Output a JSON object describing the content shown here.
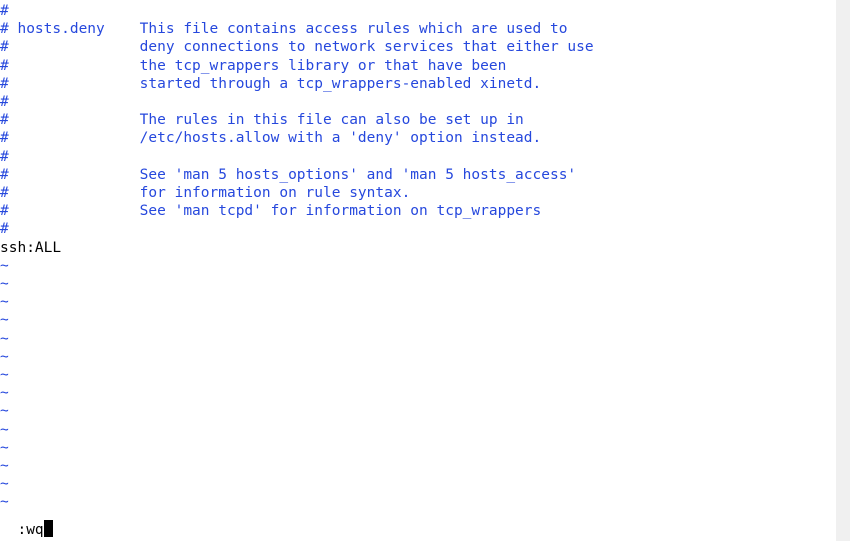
{
  "file_lines": [
    "#",
    "# hosts.deny    This file contains access rules which are used to",
    "#               deny connections to network services that either use",
    "#               the tcp_wrappers library or that have been",
    "#               started through a tcp_wrappers-enabled xinetd.",
    "#",
    "#               The rules in this file can also be set up in",
    "#               /etc/hosts.allow with a 'deny' option instead.",
    "#",
    "#               See 'man 5 hosts_options' and 'man 5 hosts_access'",
    "#               for information on rule syntax.",
    "#               See 'man tcpd' for information on tcp_wrappers",
    "#"
  ],
  "content_line": "ssh:ALL",
  "tilde": "~",
  "command": ":wq"
}
